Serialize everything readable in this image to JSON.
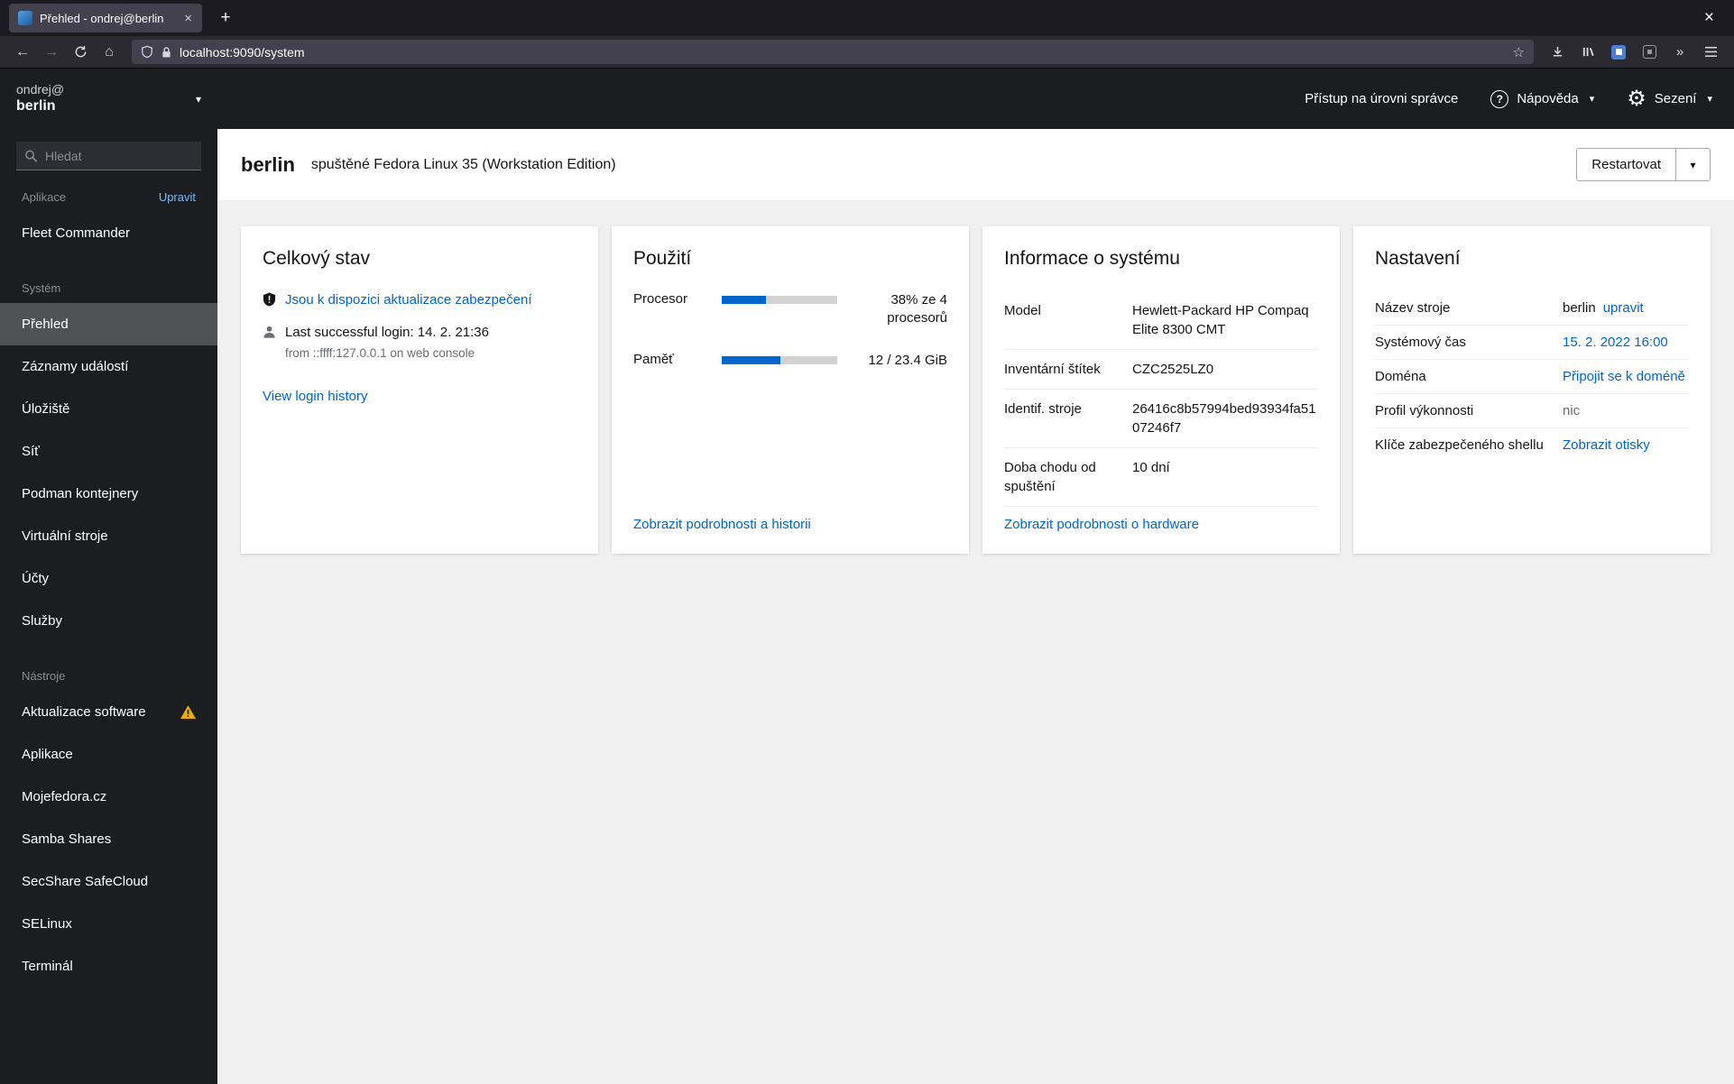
{
  "browser": {
    "tab_title": "Přehled - ondrej@berlin",
    "tab_close": "×",
    "new_tab": "+",
    "window_close": "×",
    "back": "←",
    "forward": "→",
    "home": "⌂",
    "url": "localhost:9090/system",
    "bookmark_star": "☆",
    "overflow": "»"
  },
  "masthead": {
    "admin_access": "Přístup na úrovni správce",
    "help_icon": "?",
    "help_label": "Nápověda",
    "gear_icon": "⚙",
    "session_label": "Sezení",
    "caret": "▾"
  },
  "sidebar": {
    "user_line1": "ondrej@",
    "user_line2": "berlin",
    "caret": "▾",
    "search_placeholder": "Hledat",
    "apps": {
      "heading": "Aplikace",
      "edit_link": "Upravit",
      "items": [
        {
          "label": "Fleet Commander"
        }
      ]
    },
    "system": {
      "heading": "Systém",
      "items": [
        {
          "label": "Přehled"
        },
        {
          "label": "Záznamy událostí"
        },
        {
          "label": "Úložiště"
        },
        {
          "label": "Síť"
        },
        {
          "label": "Podman kontejnery"
        },
        {
          "label": "Virtuální stroje"
        },
        {
          "label": "Účty"
        },
        {
          "label": "Služby"
        }
      ]
    },
    "tools": {
      "heading": "Nástroje",
      "items": [
        {
          "label": "Aktualizace software"
        },
        {
          "label": "Aplikace"
        },
        {
          "label": "Mojefedora.cz"
        },
        {
          "label": "Samba Shares"
        },
        {
          "label": "SecShare SafeCloud"
        },
        {
          "label": "SELinux"
        },
        {
          "label": "Terminál"
        }
      ]
    }
  },
  "page": {
    "hostname": "berlin",
    "subtitle": "spuštěné Fedora Linux 35 (Workstation Edition)",
    "restart_label": "Restartovat",
    "caret": "▾"
  },
  "cards": {
    "health": {
      "title": "Celkový stav",
      "security_link": "Jsou k dispozici aktualizace zabezpečení",
      "login_text": "Last successful login: 14. 2. 21:36",
      "login_from": "from ::ffff:127.0.0.1 on web console",
      "history_link": "View login history"
    },
    "usage": {
      "title": "Použití",
      "cpu": {
        "label": "Procesor",
        "value": "38% ze 4 procesorů",
        "percent": 38
      },
      "mem": {
        "label": "Paměť",
        "value": "12 / 23.4 GiB",
        "percent": 51
      },
      "details_link": "Zobrazit podrobnosti a historii"
    },
    "sysinfo": {
      "title": "Informace o systému",
      "rows": [
        {
          "label": "Model",
          "value": "Hewlett-Packard HP Compaq Elite 8300 CMT"
        },
        {
          "label": "Inventární štítek",
          "value": "CZC2525LZ0"
        },
        {
          "label": "Identif. stroje",
          "value": "26416c8b57994bed93934fa5107246f7"
        },
        {
          "label": "Doba chodu od spuštění",
          "value": "10 dní"
        }
      ],
      "hardware_link": "Zobrazit podrobnosti o hardware"
    },
    "config": {
      "title": "Nastavení",
      "rows": [
        {
          "label": "Název stroje",
          "value": "berlin",
          "link": "upravit"
        },
        {
          "label": "Systémový čas",
          "link": "15. 2. 2022 16:00"
        },
        {
          "label": "Doména",
          "link": "Připojit se k doméně"
        },
        {
          "label": "Profil výkonnosti",
          "muted": "nic"
        },
        {
          "label": "Klíče zabezpečeného shellu",
          "link": "Zobrazit otisky"
        }
      ]
    }
  },
  "colors": {
    "accent_link": "#0066cc",
    "progress_fill": "#0066cc",
    "warning": "#f0ab00",
    "masthead_bg": "#1b1d21",
    "sidebar_selected": "#4f5255",
    "content_bg": "#f0f0f0"
  }
}
